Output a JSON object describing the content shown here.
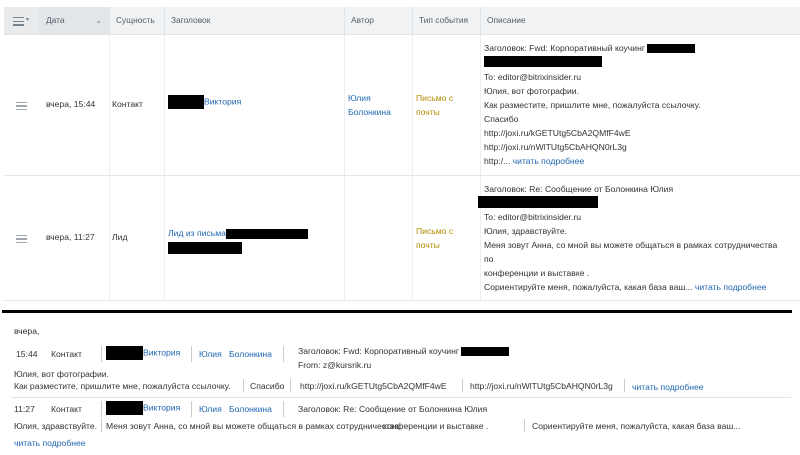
{
  "grid": {
    "headers": {
      "date": "Дата",
      "entity": "Сущность",
      "title": "Заголовок",
      "author": "Автор",
      "event_type": "Тип события",
      "description": "Описание"
    },
    "rows": [
      {
        "date": "вчера, 15:44",
        "entity": "Контакт",
        "title_link": "Виктория",
        "author_first": "Юлия",
        "author_last": "Болонкина",
        "event_line1": "Письмо с",
        "event_line2": "почты",
        "desc_subject": "Заголовок: Fwd: Корпоративный коучинг",
        "desc_lines": [
          "To: editor@bitrixinsider.ru",
          "Юлия, вот фотографии.",
          "Как разместите, пришлите мне, пожалуйста ссылочку.",
          "Спасибо",
          "http://joxi.ru/kGETUtg5CbA2QMfF4wE",
          "http://joxi.ru/nWlTUtg5CbAHQN0rL3g"
        ],
        "desc_tail": "http:/...",
        "read_more": "читать подробнее"
      },
      {
        "date": "вчера, 11:27",
        "entity": "Лид",
        "title_link": "Лид из письма",
        "author_first": "",
        "author_last": "",
        "event_line1": "Письмо с",
        "event_line2": "почты",
        "desc_subject": "Заголовок: Re: Сообщение от Болонкина Юлия",
        "desc_lines": [
          "To: editor@bitrixinsider.ru",
          "Юлия, здравствуйте.",
          "Меня зовут Анна, со мной вы можете общаться в рамках сотрудничества",
          "по",
          "конференции и выставке ."
        ],
        "desc_tail": "Сориентируйте меня, пожалуйста, какая база ваш...",
        "read_more": "читать подробнее"
      }
    ]
  },
  "list": {
    "day_label": "вчера,",
    "items": [
      {
        "time": "15:44",
        "entity": "Контакт",
        "name": "Виктория",
        "author_first": "Юлия",
        "author_last": "Болонкина",
        "subject": "Заголовок: Fwd: Корпоративный коучинг",
        "from": "From: z@kursrik.ru",
        "body1": "Юлия, вот фотографии.",
        "body2": "Как разместите, пришлите мне, пожалуйста ссылочку.",
        "body2b": "Спасибо",
        "url1": "http://joxi.ru/kGETUtg5CbA2QMfF4wE",
        "url2": "http://joxi.ru/nWlTUtg5CbAHQN0rL3g",
        "read_more": "читать подробнее"
      },
      {
        "time": "11:27",
        "entity": "Контакт",
        "name": "Виктория",
        "author_first": "Юлия",
        "author_last": "Болонкина",
        "subject": "Заголовок: Re: Сообщение от Болонкина Юлия",
        "body1": "Юлия, здравствуйте.",
        "body1b": "Меня зовут Анна, со мной вы можете общаться в рамках сотрудничества",
        "body1c": "конференции и выставке .",
        "body1d": "Сориентируйте меня, пожалуйста, какая база ваш...",
        "read_more": "читать подробнее"
      }
    ]
  },
  "colors": {
    "link": "#2067b0",
    "event": "#b18b00",
    "header_bg": "#f0f2f3"
  }
}
